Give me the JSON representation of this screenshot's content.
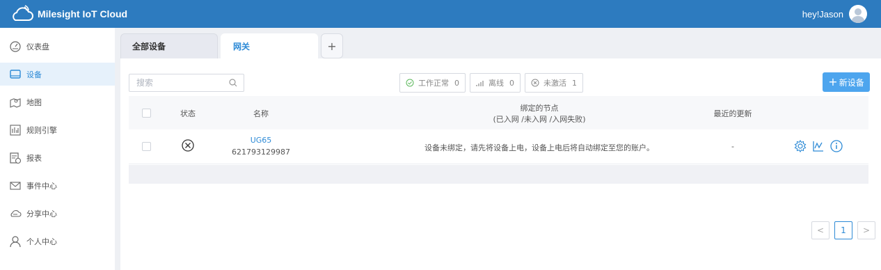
{
  "header": {
    "brand": "Milesight IoT Cloud",
    "user": "hey!Jason"
  },
  "sidebar": {
    "items": [
      {
        "label": "仪表盘",
        "icon": "dashboard-icon"
      },
      {
        "label": "设备",
        "icon": "device-icon",
        "active": true
      },
      {
        "label": "地图",
        "icon": "map-icon"
      },
      {
        "label": "规则引擎",
        "icon": "rule-engine-icon"
      },
      {
        "label": "报表",
        "icon": "report-icon"
      },
      {
        "label": "事件中心",
        "icon": "mail-icon"
      },
      {
        "label": "分享中心",
        "icon": "cloud-share-icon"
      },
      {
        "label": "个人中心",
        "icon": "person-icon"
      }
    ]
  },
  "tabs": [
    {
      "label": "全部设备"
    },
    {
      "label": "网关",
      "active": true
    }
  ],
  "toolbar": {
    "search_placeholder": "搜索",
    "filters": [
      {
        "label": "工作正常",
        "count": "0",
        "icon": "check-circle-icon"
      },
      {
        "label": "离线",
        "count": "0",
        "icon": "signal-icon"
      },
      {
        "label": "未激活",
        "count": "1",
        "icon": "x-circle-icon"
      }
    ],
    "new_button": "新设备"
  },
  "table": {
    "columns": {
      "status": "状态",
      "name": "名称",
      "nodes": "绑定的节点",
      "nodes_sub": "(已入网 /未入网 /入网失败)",
      "updated": "最近的更新"
    },
    "rows": [
      {
        "status_icon": "x-circle-icon",
        "name": "UG65",
        "serial": "621793129987",
        "nodes": "设备未绑定，请先将设备上电，设备上电后将自动绑定至您的账户。",
        "updated": "-"
      }
    ]
  },
  "pagination": {
    "prev": "<",
    "current": "1",
    "next": ">"
  },
  "colors": {
    "header": "#2d7bbf",
    "accent": "#2d8ad6",
    "button": "#4da5ee"
  }
}
